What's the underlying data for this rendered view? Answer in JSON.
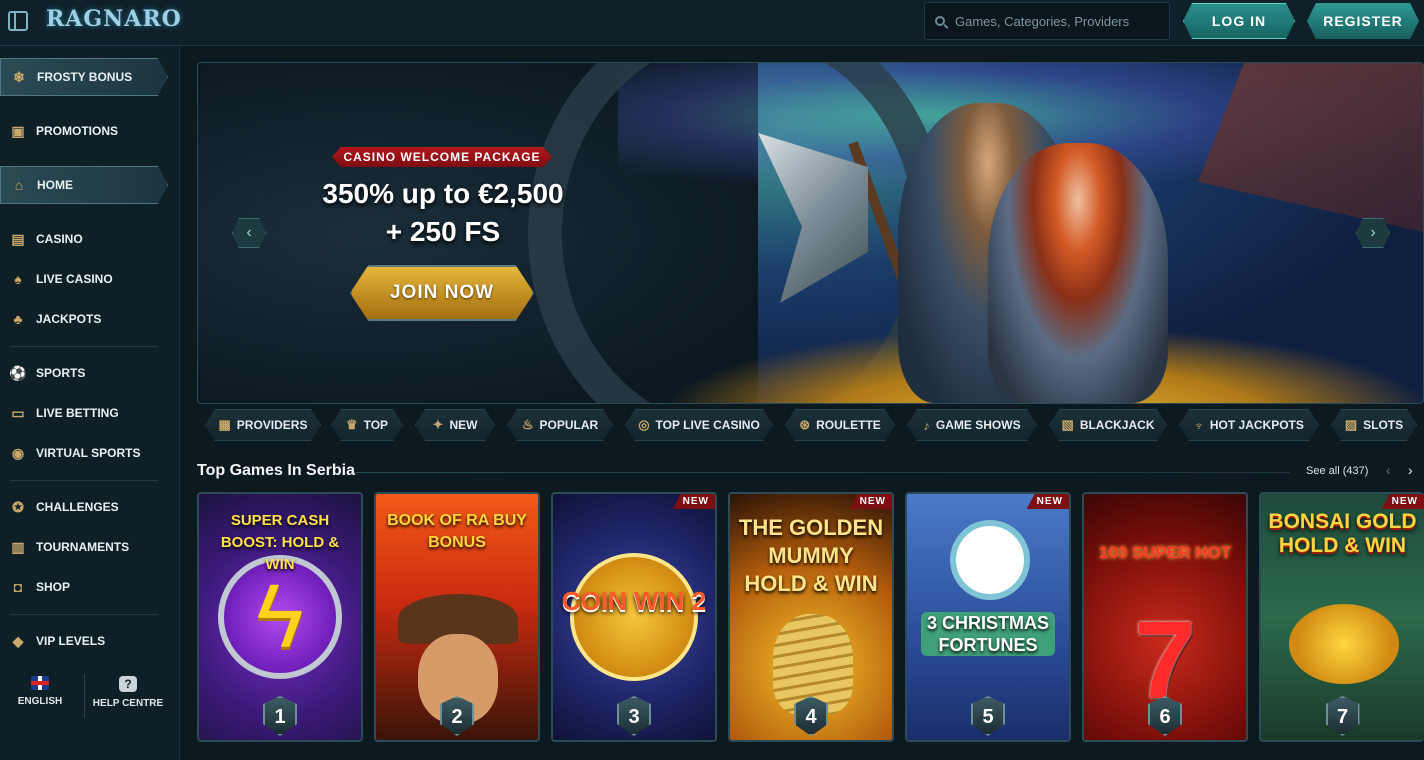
{
  "header": {
    "logo_text": "RAGNARO",
    "search_placeholder": "Games, Categories, Providers",
    "login_label": "LOG IN",
    "register_label": "REGISTER"
  },
  "sidebar": {
    "items": [
      {
        "label": "FROSTY BONUS",
        "icon": "snowflake-icon"
      },
      {
        "label": "PROMOTIONS",
        "icon": "gift-icon"
      },
      {
        "label": "HOME",
        "icon": "home-icon"
      },
      {
        "label": "CASINO",
        "icon": "slot-machine-icon"
      },
      {
        "label": "LIVE CASINO",
        "icon": "card-dealer-icon"
      },
      {
        "label": "JACKPOTS",
        "icon": "clover-icon"
      },
      {
        "label": "SPORTS",
        "icon": "ball-icon"
      },
      {
        "label": "LIVE BETTING",
        "icon": "live-icon"
      },
      {
        "label": "VIRTUAL SPORTS",
        "icon": "virtual-icon"
      },
      {
        "label": "CHALLENGES",
        "icon": "medal-icon"
      },
      {
        "label": "TOURNAMENTS",
        "icon": "podium-icon"
      },
      {
        "label": "SHOP",
        "icon": "bag-icon"
      },
      {
        "label": "VIP LEVELS",
        "icon": "diamond-icon"
      }
    ],
    "language_label": "ENGLISH",
    "help_label": "HELP CENTRE"
  },
  "banner": {
    "tag": "CASINO WELCOME PACKAGE",
    "title_line1": "350% up to €2,500",
    "title_line2": "+ 250 FS",
    "cta": "JOIN NOW"
  },
  "categories": [
    {
      "label": "PROVIDERS",
      "icon": "scroll-icon"
    },
    {
      "label": "TOP",
      "icon": "trophy-icon"
    },
    {
      "label": "NEW",
      "icon": "sparkle-icon"
    },
    {
      "label": "POPULAR",
      "icon": "fire-icon"
    },
    {
      "label": "TOP LIVE CASINO",
      "icon": "chip-icon"
    },
    {
      "label": "ROULETTE",
      "icon": "roulette-icon"
    },
    {
      "label": "GAME SHOWS",
      "icon": "microphone-icon"
    },
    {
      "label": "BLACKJACK",
      "icon": "cards-icon"
    },
    {
      "label": "HOT JACKPOTS",
      "icon": "pot-icon"
    },
    {
      "label": "SLOTS",
      "icon": "slots-icon"
    }
  ],
  "top_games": {
    "title": "Top Games In Serbia",
    "see_all": "See all (437)",
    "games": [
      {
        "name": "SUPER CASH BOOST: HOLD & WIN",
        "rank": "1",
        "new_tag": ""
      },
      {
        "name": "BOOK OF RA BUY BONUS",
        "rank": "2",
        "new_tag": ""
      },
      {
        "name": "COIN WIN 2",
        "rank": "3",
        "new_tag": "NEW"
      },
      {
        "name": "THE GOLDEN MUMMY HOLD & WIN",
        "rank": "4",
        "new_tag": "NEW"
      },
      {
        "name": "3 CHRISTMAS FORTUNES",
        "rank": "5",
        "new_tag": "NEW"
      },
      {
        "name": "100 SUPER HOT",
        "rank": "6",
        "new_tag": ""
      },
      {
        "name": "BONSAI GOLD HOLD & WIN",
        "rank": "7",
        "new_tag": "NEW"
      }
    ]
  }
}
